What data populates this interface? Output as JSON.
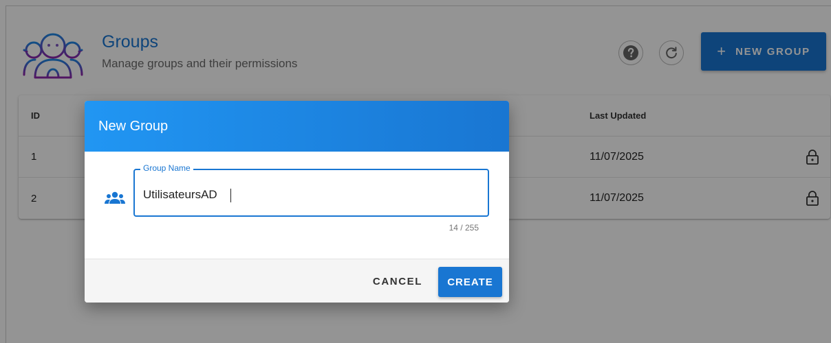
{
  "header": {
    "title": "Groups",
    "subtitle": "Manage groups and their permissions",
    "new_group_label": "NEW GROUP",
    "logo_icon": "group-people-icon",
    "help_icon": "help-icon",
    "refresh_icon": "refresh-icon"
  },
  "table": {
    "columns": {
      "id": "ID",
      "last_updated": "Last Updated"
    },
    "rows": [
      {
        "id": "1",
        "last_updated": "11/07/2025",
        "icon": "lock-icon"
      },
      {
        "id": "2",
        "last_updated": "11/07/2025",
        "icon": "lock-icon"
      }
    ]
  },
  "dialog": {
    "title": "New Group",
    "field_label": "Group Name",
    "field_value": "UtilisateursAD",
    "char_count": "14 / 255",
    "cancel_label": "CANCEL",
    "create_label": "CREATE",
    "field_icon": "users-icon"
  },
  "colors": {
    "primary": "#1976d2",
    "logo_purple": "#8e24aa",
    "overlay": "rgba(0,0,0,0.42)"
  }
}
